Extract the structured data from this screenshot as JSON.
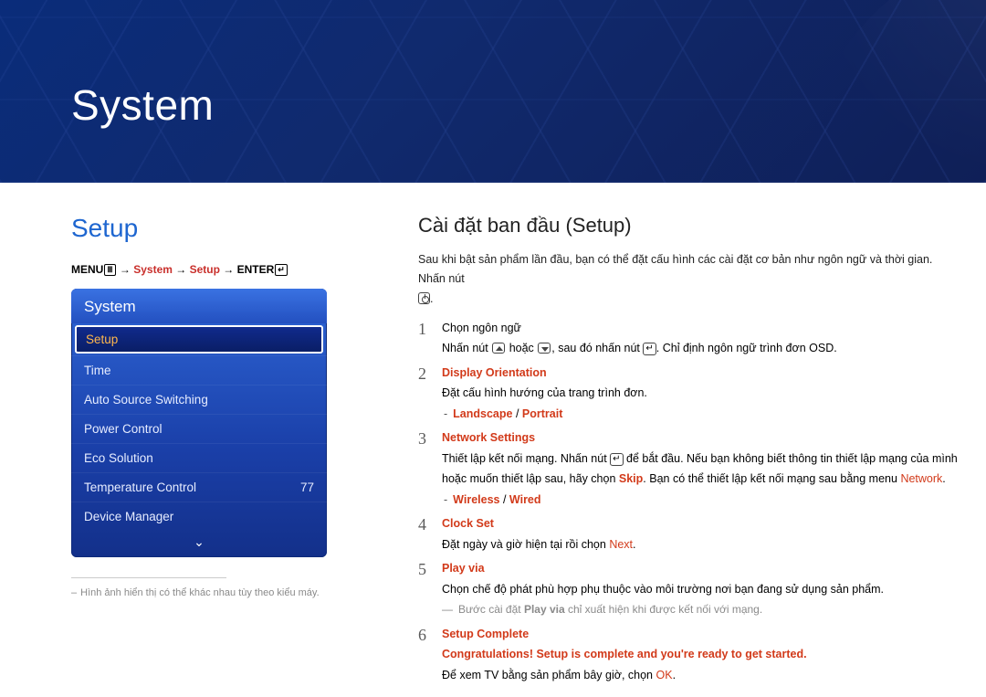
{
  "banner": {
    "title": "System"
  },
  "left": {
    "heading": "Setup",
    "nav": {
      "menu_label": "MENU",
      "menu_glyph": "Ⅲ",
      "arrow": " → ",
      "crumb1": "System",
      "crumb2": "Setup",
      "enter_label": "ENTER",
      "enter_glyph": "↵"
    },
    "osd": {
      "title": "System",
      "items": [
        {
          "label": "Setup",
          "value": "",
          "selected": true
        },
        {
          "label": "Time",
          "value": ""
        },
        {
          "label": "Auto Source Switching",
          "value": ""
        },
        {
          "label": "Power Control",
          "value": ""
        },
        {
          "label": "Eco Solution",
          "value": ""
        },
        {
          "label": "Temperature Control",
          "value": "77"
        },
        {
          "label": "Device Manager",
          "value": ""
        }
      ],
      "more_glyph": "⌄"
    },
    "note": "Hình ảnh hiển thị có thể khác nhau tùy theo kiểu máy."
  },
  "right": {
    "heading": "Cài đặt ban đầu (Setup)",
    "intro": "Sau khi bật sản phẩm lần đầu, bạn có thể đặt cấu hình các cài đặt cơ bản như ngôn ngữ và thời gian. Nhấn nút ",
    "intro_tail": ".",
    "steps": [
      {
        "num": "1",
        "title_plain": "Chọn ngôn ngữ",
        "body_pre": "Nhấn nút ",
        "body_mid": " hoặc ",
        "body_post1": ", sau đó nhấn nút ",
        "body_post2": ". Chỉ định ngôn ngữ trình đơn OSD."
      },
      {
        "num": "2",
        "title_red": "Display Orientation",
        "body1": "Đặt cấu hình hướng của trang trình đơn.",
        "sub_options": [
          "Landscape",
          "Portrait"
        ]
      },
      {
        "num": "3",
        "title_red": "Network Settings",
        "body_pre": "Thiết lập kết nối mạng. Nhấn nút ",
        "body_mid": " để bắt đầu. Nếu bạn không biết thông tin thiết lập mạng của mình hoặc muốn thiết lập sau, hãy chọn ",
        "skip": "Skip",
        "body_post": ". Bạn có thể thiết lập kết nối mạng sau bằng menu ",
        "network": "Network",
        "tail": ".",
        "sub_options": [
          "Wireless",
          "Wired"
        ]
      },
      {
        "num": "4",
        "title_red": "Clock Set",
        "body_pre": "Đặt ngày và giờ hiện tại rồi chọn ",
        "next": "Next",
        "tail": "."
      },
      {
        "num": "5",
        "title_red": "Play via",
        "body1": "Chọn chế độ phát phù hợp phụ thuộc vào môi trường nơi bạn đang sử dụng sản phẩm.",
        "note_pre": "Bước cài đặt ",
        "note_bold": "Play via",
        "note_post": " chỉ xuất hiện khi được kết nối với mạng."
      },
      {
        "num": "6",
        "title_red": "Setup Complete",
        "congrats": "Congratulations! Setup is complete and you're ready to get started.",
        "body_pre": "Để xem TV bằng sản phẩm bây giờ, chọn ",
        "ok": "OK",
        "tail": "."
      }
    ]
  }
}
